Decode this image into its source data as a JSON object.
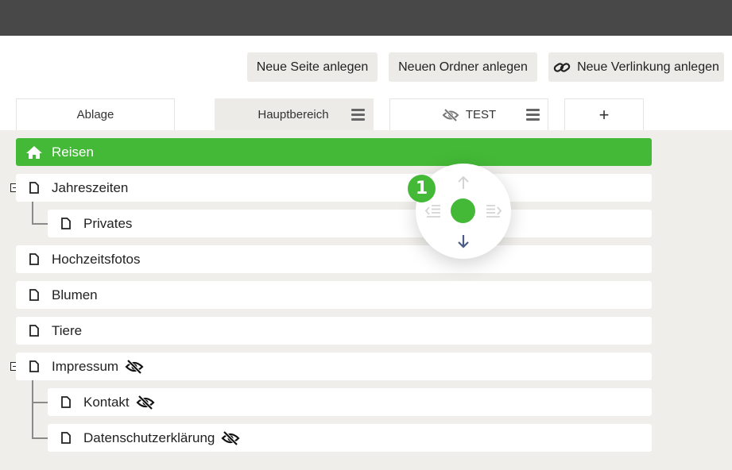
{
  "toolbar": {
    "new_page": "Neue Seite anlegen",
    "new_folder": "Neuen Ordner anlegen",
    "new_link": "Neue Verlinkung anlegen"
  },
  "tabs": [
    {
      "label": "Ablage",
      "active": false
    },
    {
      "label": "Hauptbereich",
      "active": true
    },
    {
      "label": "TEST",
      "hidden": true
    },
    {
      "label": "+"
    }
  ],
  "tree": {
    "root": "Reisen",
    "items": [
      {
        "label": "Jahreszeiten",
        "collapse_toggle": "minus"
      },
      {
        "label": "Privates"
      },
      {
        "label": "Hochzeitsfotos"
      },
      {
        "label": "Blumen"
      },
      {
        "label": "Tiere"
      },
      {
        "label": "Impressum",
        "collapse_toggle": "minus",
        "hidden": true
      },
      {
        "label": "Kontakt",
        "hidden": true
      },
      {
        "label": "Datenschutzerklärung",
        "hidden": true
      }
    ]
  },
  "mover": {
    "step_badge": "1",
    "icons": [
      "arrow-up-icon",
      "outdent-icon",
      "indent-icon",
      "arrow-down-icon"
    ]
  },
  "colors": {
    "accent": "#44b937",
    "topbar": "#484848",
    "background": "#efeeea",
    "button_bg": "#ecebe7",
    "move_down_arrow": "#4a5d87"
  }
}
